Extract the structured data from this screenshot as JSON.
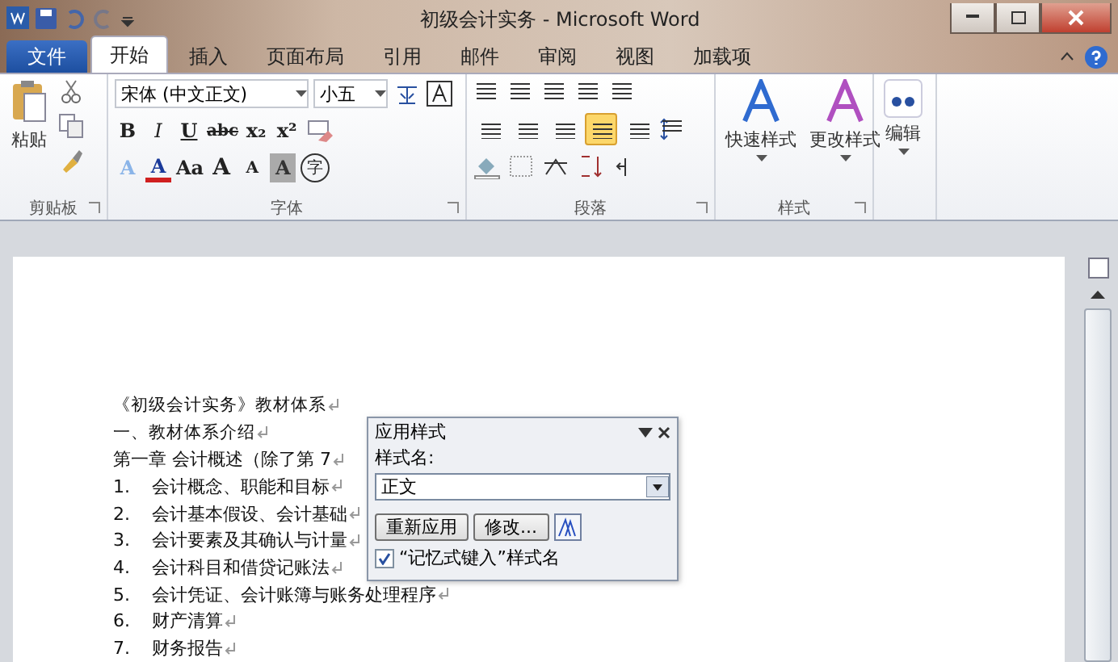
{
  "window": {
    "title": "初级会计实务  -  Microsoft Word"
  },
  "tabs": [
    {
      "label": "文件",
      "kind": "file",
      "selected": false
    },
    {
      "label": "开始",
      "kind": "tab",
      "selected": true
    },
    {
      "label": "插入",
      "kind": "tab",
      "selected": false
    },
    {
      "label": "页面布局",
      "kind": "tab",
      "selected": false
    },
    {
      "label": "引用",
      "kind": "tab",
      "selected": false
    },
    {
      "label": "邮件",
      "kind": "tab",
      "selected": false
    },
    {
      "label": "审阅",
      "kind": "tab",
      "selected": false
    },
    {
      "label": "视图",
      "kind": "tab",
      "selected": false
    },
    {
      "label": "加载项",
      "kind": "tab",
      "selected": false
    }
  ],
  "ribbon": {
    "clipboard": {
      "paste_label": "粘贴",
      "group_label": "剪贴板"
    },
    "font": {
      "font_name": "宋体 (中文正文)",
      "font_size": "小五",
      "group_label": "字体",
      "row1": [
        {
          "text": "B",
          "kind": "bold"
        },
        {
          "text": "I",
          "kind": "italic"
        },
        {
          "text": "U",
          "kind": "underline"
        },
        {
          "text": "abc",
          "kind": "strike"
        },
        {
          "text": "x₂",
          "kind": "plain"
        },
        {
          "text": "x²",
          "kind": "plain"
        }
      ],
      "row2": [
        {
          "text": "A",
          "kind": "outline"
        },
        {
          "text": "A",
          "kind": "red"
        },
        {
          "text": "Aa",
          "kind": "plain"
        },
        {
          "text": "A",
          "kind": "grow"
        },
        {
          "text": "A",
          "kind": "shrink"
        },
        {
          "text": "A",
          "kind": "shaded"
        },
        {
          "text": "字",
          "kind": "circled"
        }
      ]
    },
    "paragraph": {
      "group_label": "段落",
      "alignments": [
        {
          "selected": false
        },
        {
          "selected": false
        },
        {
          "selected": false
        },
        {
          "selected": true
        },
        {
          "selected": false
        }
      ]
    },
    "styles": {
      "group_label": "样式",
      "buttons": [
        "快速样式",
        "更改样式"
      ]
    },
    "editing": {
      "label": "编辑"
    }
  },
  "document": {
    "paragraph_marks": true,
    "lines": [
      {
        "kind": "heading",
        "text": "《初级会计实务》教材体系"
      },
      {
        "kind": "heading",
        "text": "一、教材体系介绍"
      },
      {
        "kind": "plain",
        "text": "第一章  会计概述（除了第 7"
      },
      {
        "kind": "numbered",
        "number": "1.",
        "text": "会计概念、职能和目标"
      },
      {
        "kind": "numbered",
        "number": "2.",
        "text": "会计基本假设、会计基础"
      },
      {
        "kind": "numbered",
        "number": "3.",
        "text": "会计要素及其确认与计量"
      },
      {
        "kind": "numbered",
        "number": "4.",
        "text": "会计科目和借贷记账法"
      },
      {
        "kind": "numbered",
        "number": "5.",
        "text": "会计凭证、会计账簿与账务处理程序"
      },
      {
        "kind": "numbered",
        "number": "6.",
        "text": "财产清算"
      },
      {
        "kind": "numbered",
        "number": "7.",
        "text": "财务报告"
      }
    ]
  },
  "dialog": {
    "title": "应用样式",
    "field_label": "样式名:",
    "style_name": "正文",
    "buttons": [
      "重新应用",
      "修改..."
    ],
    "checkbox": {
      "label": "“记忆式键入”样式名",
      "checked": true
    }
  }
}
